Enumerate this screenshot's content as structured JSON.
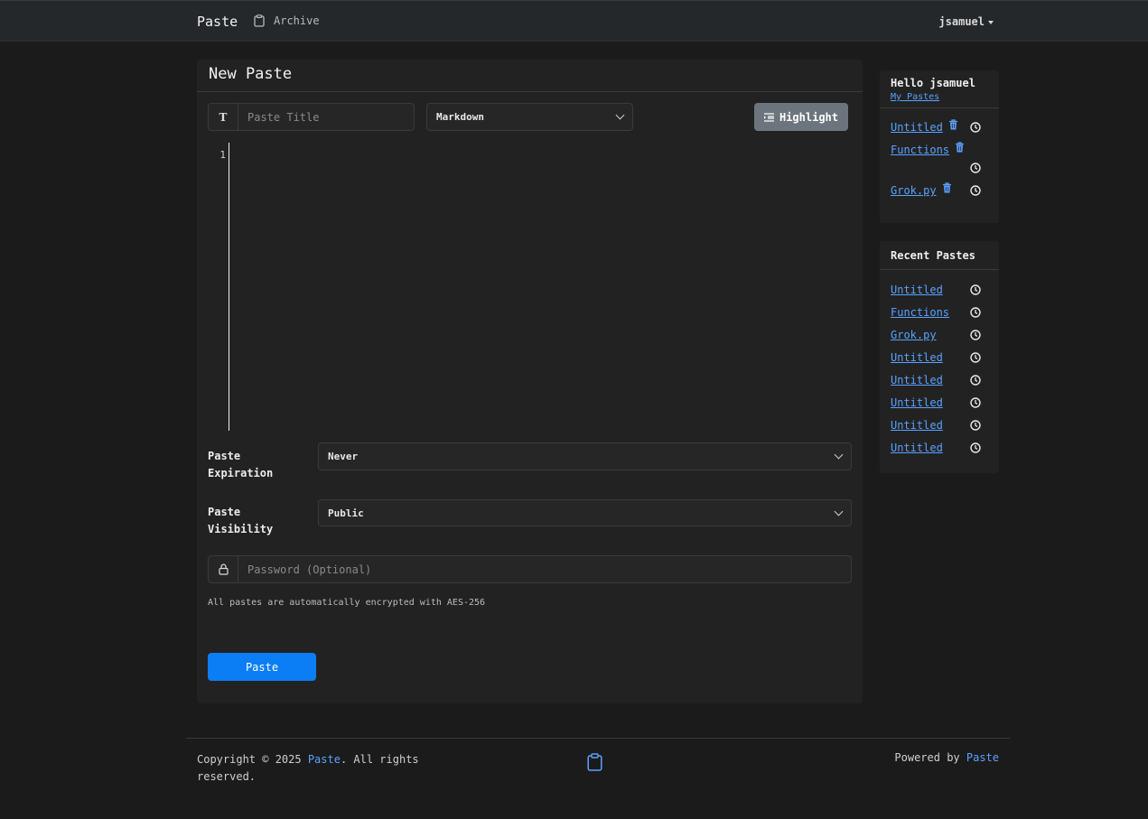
{
  "nav": {
    "brand": "Paste",
    "archive_label": "Archive",
    "user": "jsamuel"
  },
  "main": {
    "title": "New Paste",
    "title_placeholder": "Paste Title",
    "title_addon": "T",
    "language": "Markdown",
    "highlight_label": "Highlight",
    "line_number": "1",
    "expiration_label": "Paste Expiration",
    "expiration_value": "Never",
    "visibility_label": "Paste Visibility",
    "visibility_value": "Public",
    "password_placeholder": "Password (Optional)",
    "encryption_note": "All pastes are automatically encrypted with AES-256",
    "paste_button": "Paste"
  },
  "user_card": {
    "greeting": "Hello jsamuel",
    "my_pastes_link": "My Pastes",
    "items": [
      "Untitled",
      "Functions",
      "Grok.py"
    ]
  },
  "recent_card": {
    "title": "Recent Pastes",
    "items": [
      "Untitled",
      "Functions",
      "Grok.py",
      "Untitled",
      "Untitled",
      "Untitled",
      "Untitled",
      "Untitled"
    ]
  },
  "footer": {
    "copyright_prefix": "Copyright © 2025 ",
    "copyright_link": "Paste",
    "copyright_suffix": ". All rights reserved.",
    "powered_prefix": "Powered by ",
    "powered_link": "Paste"
  },
  "colors": {
    "accent": "#0b7ef6",
    "link": "#5aa2ff",
    "background": "#1b1b1b",
    "card": "#222222"
  },
  "icons": {
    "archive": "clipboard-icon",
    "title_addon": "text-icon",
    "highlight": "indent-icon",
    "password": "lock-icon",
    "delete": "trash-icon",
    "time": "clock-icon",
    "footer": "clipboard-icon"
  }
}
